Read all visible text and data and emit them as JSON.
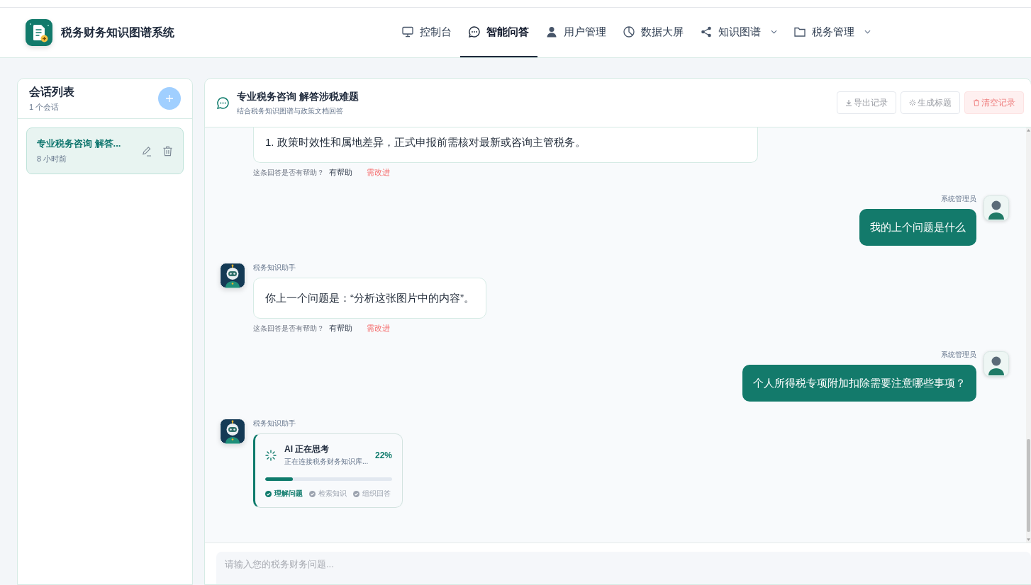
{
  "header": {
    "app_title": "税务财务知识图谱系统",
    "nav": [
      {
        "kind": "console",
        "label": "控制台",
        "selected": false,
        "dropdown": false
      },
      {
        "kind": "qa",
        "label": "智能问答",
        "selected": true,
        "dropdown": false
      },
      {
        "kind": "users",
        "label": "用户管理",
        "selected": false,
        "dropdown": false
      },
      {
        "kind": "screen",
        "label": "数据大屏",
        "selected": false,
        "dropdown": false
      },
      {
        "kind": "graph",
        "label": "知识图谱",
        "selected": false,
        "dropdown": true
      },
      {
        "kind": "tax",
        "label": "税务管理",
        "selected": false,
        "dropdown": true
      }
    ]
  },
  "sidebar": {
    "title": "会话列表",
    "count": "1 个会话",
    "conversations": [
      {
        "title": "专业税务咨询 解答...",
        "time": "8 小时前",
        "selected": true
      }
    ]
  },
  "chat": {
    "title": "专业税务咨询 解答涉税难题",
    "subtitle": "结合税务知识图谱与政策文档回答",
    "actions": [
      {
        "kind": "export",
        "label": "导出记录",
        "disabled": true
      },
      {
        "kind": "generate",
        "label": "生成标题",
        "disabled": true
      },
      {
        "kind": "clear",
        "label": "清空记录",
        "disabled": true
      }
    ],
    "messages": [
      {
        "kind": "answer",
        "clipped": true,
        "text": "1. 政策时效性和属地差异，正式申报前需核对最新或咨询主管税务。",
        "feedback": {
          "question": "这条回答是否有帮助？",
          "helpful": "有帮助",
          "improve": "需改进"
        }
      },
      {
        "kind": "question",
        "sender": "系统管理员",
        "text": "我的上个问题是什么"
      },
      {
        "kind": "answer",
        "clipped": false,
        "sender": "税务知识助手",
        "text": "你上一个问题是：“分析这张图片中的内容”。",
        "feedback": {
          "question": "这条回答是否有帮助？",
          "helpful": "有帮助",
          "improve": "需改进"
        }
      },
      {
        "kind": "question",
        "sender": "系统管理员",
        "text": "个人所得税专项附加扣除需要注意哪些事项？"
      },
      {
        "kind": "thinking",
        "sender": "税务知识助手",
        "title": "AI 正在思考",
        "detail": "正在连接税务财务知识库...",
        "percent": "22%",
        "level": 0.22,
        "steps": [
          {
            "label": "理解问题",
            "done": true
          },
          {
            "label": "检索知识",
            "done": false
          },
          {
            "label": "组织回答",
            "done": false
          }
        ]
      }
    ],
    "input": {
      "placeholder": "请输入您的税务财务问题..."
    }
  }
}
